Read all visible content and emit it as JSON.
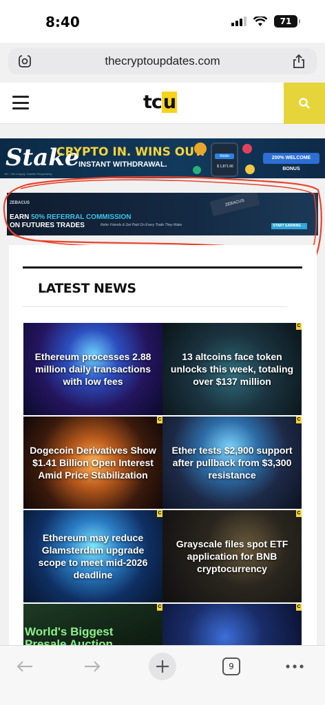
{
  "status": {
    "time": "8:40",
    "battery": "71"
  },
  "browser": {
    "url": "thecryptoupdates.com",
    "tab_count": "9"
  },
  "site": {
    "logo_main": "tc",
    "logo_highlight": "u"
  },
  "stake_ad": {
    "brand": "Stake",
    "headline": "CRYPTO IN. WINS OUT.",
    "subline": "INSTANT WITHDRAWAL.",
    "fine_print": "18+. T&C's Apply. Gamble Responsibly.",
    "phone_button": "Wallet",
    "phone_amount": "$ 1,871.66",
    "bonus_label": "200% WELCOME BONUS"
  },
  "zebacus_ad": {
    "brand": "ZEBACUS",
    "line1_prefix": "EARN ",
    "line1_highlight": "50% REFERRAL COMMISSION",
    "line2": "ON FUTURES TRADES",
    "sub": "Refer Friends & Get Paid On Every Trade They Make",
    "cta": "START EARNING →",
    "card_label": "ZEBACUS"
  },
  "news": {
    "heading": "LATEST NEWS",
    "badge": "C",
    "items": [
      {
        "title": "Ethereum processes 2.88 million daily transactions with low fees"
      },
      {
        "title": "13 altcoins face token unlocks this week, totaling over $137 million"
      },
      {
        "title": "Dogecoin Derivatives Show $1.41 Billion Open Interest Amid Price Stabilization"
      },
      {
        "title": "Ether tests $2,900 support after pullback from $3,300 resistance"
      },
      {
        "title": "Ethereum may reduce Glamsterdam upgrade scope to meet mid-2026 deadline"
      },
      {
        "title": "Grayscale files spot ETF application for BNB cryptocurrency"
      },
      {
        "title": "World's Biggest Presale Auction"
      },
      {
        "title": ""
      }
    ]
  },
  "colors": {
    "accent_yellow": "#e6d53a",
    "annotation_red": "#e8432a"
  },
  "icons": [
    "lens-icon",
    "share-icon",
    "hamburger-icon",
    "search-icon",
    "back-icon",
    "forward-icon",
    "plus-icon",
    "tabs-icon",
    "more-icon"
  ]
}
